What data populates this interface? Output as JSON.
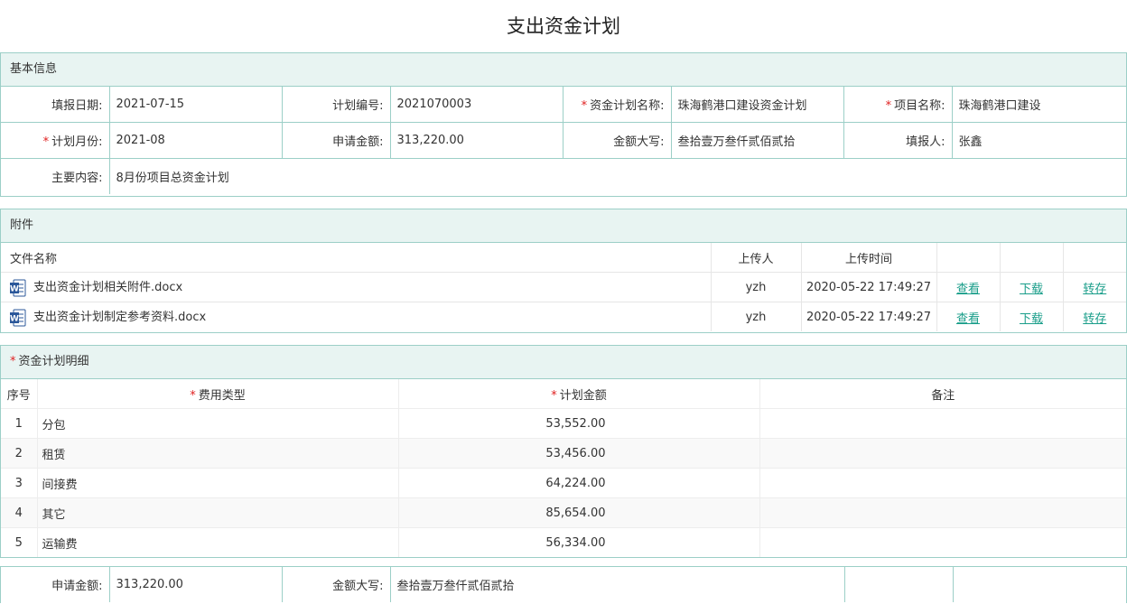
{
  "page": {
    "title": "支出资金计划"
  },
  "basic": {
    "header": "基本信息",
    "fill_date_label": "填报日期:",
    "fill_date": "2021-07-15",
    "plan_no_label": "计划编号:",
    "plan_no": "2021070003",
    "plan_name_label": "资金计划名称:",
    "plan_name": "珠海鹤港口建设资金计划",
    "project_label": "项目名称:",
    "project": "珠海鹤港口建设",
    "plan_month_label": "计划月份:",
    "plan_month": "2021-08",
    "apply_amount_label": "申请金额:",
    "apply_amount": "313,220.00",
    "amount_upper_label": "金额大写:",
    "amount_upper": "叁拾壹万叁仟贰佰贰拾",
    "reporter_label": "填报人:",
    "reporter": "张鑫",
    "content_label": "主要内容:",
    "content": "8月份项目总资金计划"
  },
  "attachments": {
    "header": "附件",
    "columns": {
      "name": "文件名称",
      "uploader": "上传人",
      "time": "上传时间"
    },
    "actions": {
      "view": "查看",
      "download": "下载",
      "transfer": "转存"
    },
    "files": [
      {
        "name": "支出资金计划相关附件.docx",
        "uploader": "yzh",
        "time": "2020-05-22 17:49:27"
      },
      {
        "name": "支出资金计划制定参考资料.docx",
        "uploader": "yzh",
        "time": "2020-05-22 17:49:27"
      }
    ]
  },
  "detail": {
    "header": "资金计划明细",
    "columns": {
      "no": "序号",
      "type": "费用类型",
      "amount": "计划金额",
      "remark": "备注"
    },
    "rows": [
      {
        "no": "1",
        "type": "分包",
        "amount": "53,552.00",
        "remark": ""
      },
      {
        "no": "2",
        "type": "租赁",
        "amount": "53,456.00",
        "remark": ""
      },
      {
        "no": "3",
        "type": "间接费",
        "amount": "64,224.00",
        "remark": ""
      },
      {
        "no": "4",
        "type": "其它",
        "amount": "85,654.00",
        "remark": ""
      },
      {
        "no": "5",
        "type": "运输费",
        "amount": "56,334.00",
        "remark": ""
      }
    ]
  },
  "summary": {
    "apply_amount_label": "申请金额:",
    "apply_amount": "313,220.00",
    "amount_upper_label": "金额大写:",
    "amount_upper": "叁拾壹万叁仟贰佰贰拾"
  },
  "colors": {
    "border": "#9ccfc7",
    "header_bg": "#e8f4f2",
    "link": "#1a9e8a",
    "required": "#e02020"
  },
  "icons": {
    "file": "word-doc-icon"
  }
}
